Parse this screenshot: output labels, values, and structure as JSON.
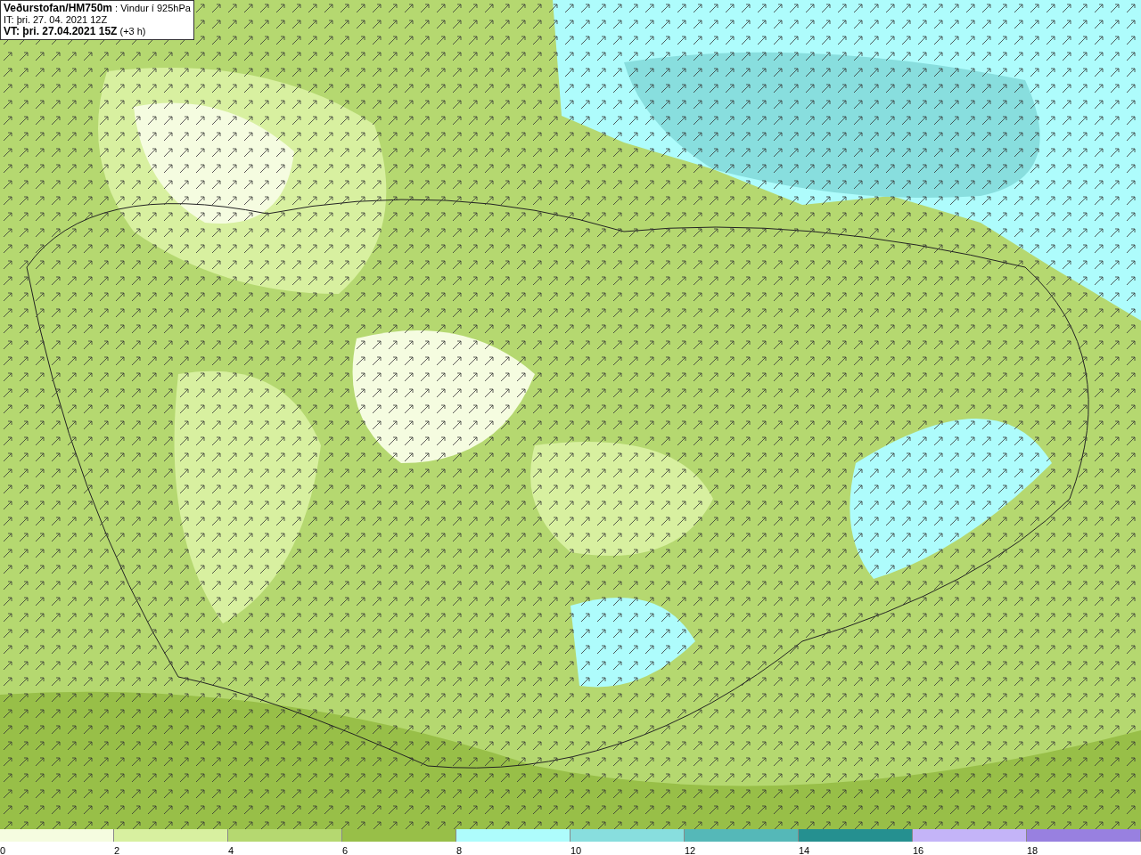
{
  "title_box": {
    "lines": [
      "**Veðurstofan/HM750m** : Vindur í 925hPa",
      "IT: þri. 27. 04. 2021 12Z",
      "**VT: þri. 27.04.2021 15Z** (+3 h)"
    ]
  },
  "legend": {
    "bins": [
      {
        "label": "0",
        "color": "#f5fce0"
      },
      {
        "label": "2",
        "color": "#d8f0a0"
      },
      {
        "label": "4",
        "color": "#b5d870"
      },
      {
        "label": "6",
        "color": "#98bf48"
      },
      {
        "label": "8",
        "color": "#aefcfc"
      },
      {
        "label": "10",
        "color": "#88dede"
      },
      {
        "label": "12",
        "color": "#55b8b8"
      },
      {
        "label": "14",
        "color": "#259090"
      },
      {
        "label": "16",
        "color": "#c4b4f8"
      },
      {
        "label": "18",
        "color": "#9880e0"
      }
    ]
  }
}
